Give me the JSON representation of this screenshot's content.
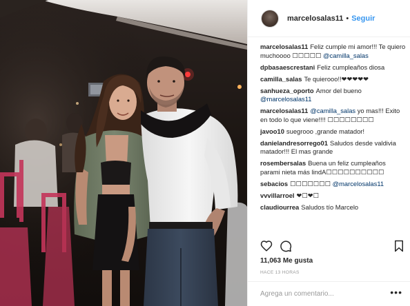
{
  "post": {
    "header": {
      "username": "marcelosalas11",
      "separator": "•",
      "follow_label": "Seguir"
    },
    "comments": [
      {
        "user": "marcelosalas11",
        "text": "Feliz cumple mi amor!!! Te quiero muchoooo ☐☐☐☐☐ ",
        "mention": "@camilla_salas",
        "after": ""
      },
      {
        "user": "dpbasaescrestani",
        "text": "Feliz cumpleaños diosa",
        "mention": "",
        "after": ""
      },
      {
        "user": "camilla_salas",
        "text": "Te quierooo!!❤❤❤❤❤",
        "mention": "",
        "after": ""
      },
      {
        "user": "sanhueza_oporto",
        "text": "Amor del bueno ",
        "mention": "@marcelosalas11",
        "after": ""
      },
      {
        "user": "marcelosalas11",
        "text": "",
        "mention": "@camilla_salas",
        "after": " yo mas!!! Exito en todo lo que viene!!!! ☐☐☐☐☐☐☐☐"
      },
      {
        "user": "javoo10",
        "text": "suegrooo ,grande matador!",
        "mention": "",
        "after": ""
      },
      {
        "user": "danielandresorrego01",
        "text": "Saludos desde valdivia matador!!! El mas grande",
        "mention": "",
        "after": ""
      },
      {
        "user": "rosembersalas",
        "text": "Buena un feliz cumpleaños parami nieta más lindA☐☐☐☐☐☐☐☐☐☐",
        "mention": "",
        "after": ""
      },
      {
        "user": "sebacios",
        "text": "☐☐☐☐☐☐☐ ",
        "mention": "@marcelosalas11",
        "after": ""
      },
      {
        "user": "vvvillarroel",
        "text": "❤☐❤☐",
        "mention": "",
        "after": ""
      },
      {
        "user": "claudiourrea",
        "text": "Saludos tío Marcelo",
        "mention": "",
        "after": ""
      }
    ],
    "actions": {
      "like_icon": "heart-icon",
      "comment_icon": "comment-bubble-icon",
      "save_icon": "bookmark-icon"
    },
    "likes_text": "11,063 Me gusta",
    "time_text": "HACE 13 HORAS",
    "add_comment": {
      "placeholder": "Agrega un comentario...",
      "more_label": "•••"
    }
  }
}
